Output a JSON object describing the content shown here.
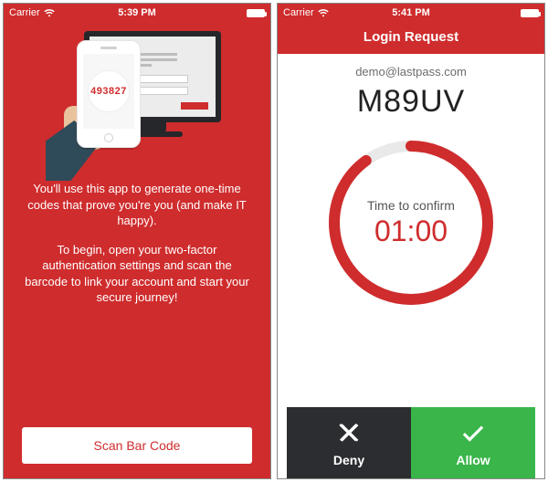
{
  "left": {
    "statusbar": {
      "carrier": "Carrier",
      "time": "5:39 PM"
    },
    "otp_sample": "493827",
    "intro_p1": "You'll use this app to generate one-time codes that prove you're you (and make IT happy).",
    "intro_p2": "To begin, open your two-factor authentication settings and scan the barcode to link your account and start your secure journey!",
    "scan_button": "Scan Bar Code"
  },
  "right": {
    "statusbar": {
      "carrier": "Carrier",
      "time": "5:41 PM"
    },
    "header_title": "Login Request",
    "account_email": "demo@lastpass.com",
    "code": "M89UV",
    "timer_label": "Time to confirm",
    "timer_value": "01:00",
    "deny_label": "Deny",
    "allow_label": "Allow"
  },
  "colors": {
    "brand_red": "#cf2c2d",
    "allow_green": "#39b54a",
    "deny_dark": "#2c2d30"
  }
}
